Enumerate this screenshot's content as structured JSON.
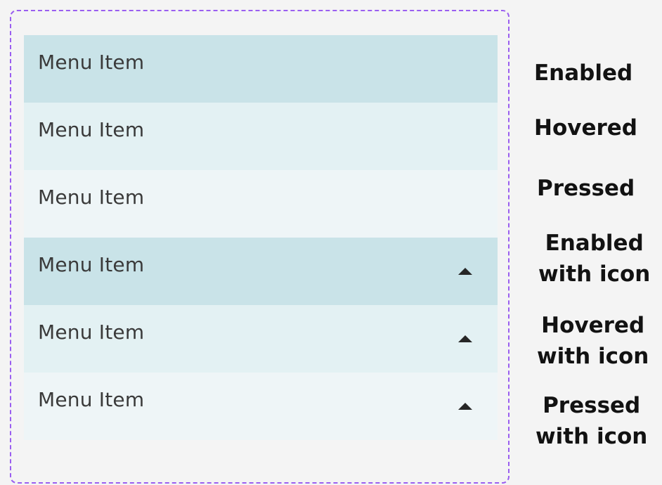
{
  "menu": {
    "items": [
      {
        "label": "Menu Item",
        "state": "enabled",
        "icon": null
      },
      {
        "label": "Menu Item",
        "state": "hovered",
        "icon": null
      },
      {
        "label": "Menu Item",
        "state": "pressed",
        "icon": null
      },
      {
        "label": "Menu Item",
        "state": "enabled",
        "icon": "arrow-up-icon"
      },
      {
        "label": "Menu Item",
        "state": "hovered",
        "icon": "arrow-up-icon"
      },
      {
        "label": "Menu Item",
        "state": "pressed",
        "icon": "arrow-up-icon"
      }
    ]
  },
  "state_labels": [
    "Enabled",
    "Hovered",
    "Pressed",
    "Enabled\nwith icon",
    "Hovered\nwith icon",
    "Pressed\nwith icon"
  ],
  "colors": {
    "frame_border": "#9a5ef0",
    "enabled_bg": "#c9e3e8",
    "hovered_bg": "#e3f1f3",
    "pressed_bg": "#eef5f7",
    "page_bg": "#f4f4f4"
  }
}
